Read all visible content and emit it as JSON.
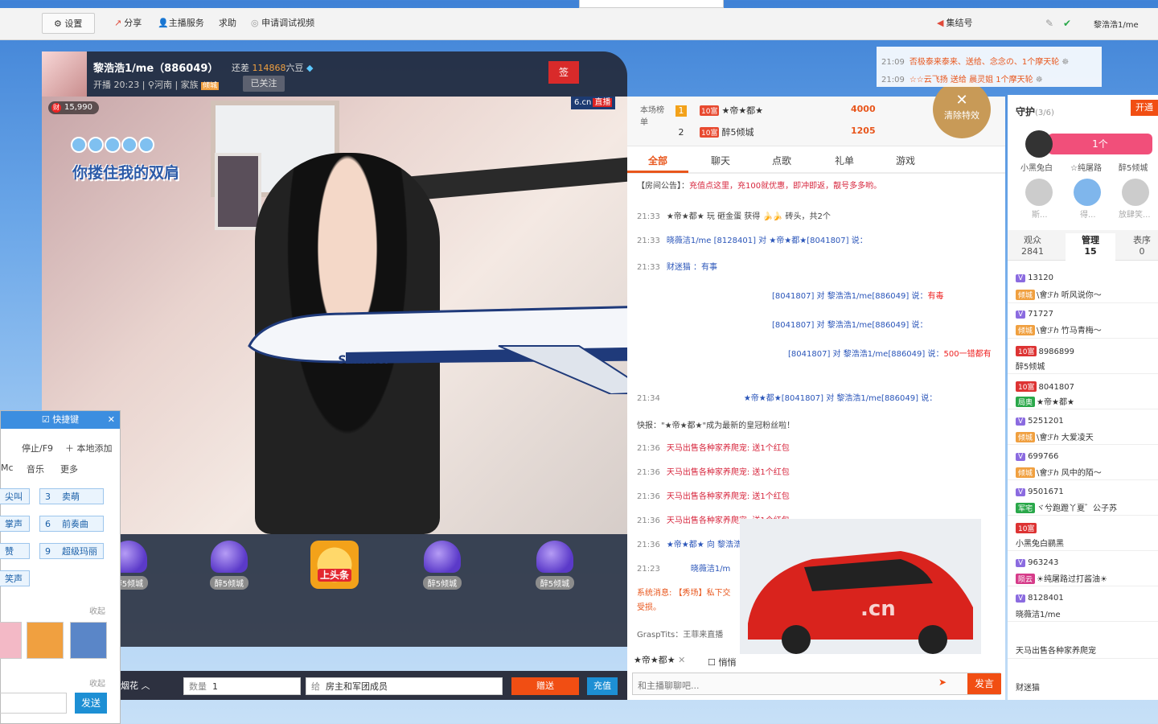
{
  "topbar": {
    "settings": "设置",
    "share": "分享",
    "anchor_service": "主播服务",
    "help": "求助",
    "apply": "申请调试视频",
    "gather": "集结号"
  },
  "topright": {
    "user": "黎浩浩1/me"
  },
  "streamer": {
    "name": "黎浩浩1/me（886049）",
    "gap_label": "还差",
    "gap_value": "114868",
    "gap_unit": "六豆",
    "start": "开播 20:23",
    "location": "河南",
    "family_label": "家族",
    "family_badge": "倾城",
    "follow": "已关注",
    "flag": "签"
  },
  "video": {
    "fortune": "15,990",
    "brand": "6.cn",
    "live": "直播",
    "title": "你搂住我的双肩"
  },
  "gifts": [
    {
      "label": "醉5倾城"
    },
    {
      "label": "醉5倾城"
    },
    {
      "label": "醉5倾城"
    },
    {
      "label": "醉5倾城"
    }
  ],
  "headline": {
    "label": "上头条"
  },
  "sendbar": {
    "gift_name": "烟花",
    "qty_label": "数量",
    "qty": "1",
    "to_label": "给",
    "to": "房主和军团成员",
    "send": "赠送",
    "charge": "充值"
  },
  "shortcut": {
    "title": "快捷键",
    "stop": "停止/F9",
    "add_local": "本地添加",
    "tab_mc": "Mc",
    "tab_music": "音乐",
    "tab_more": "更多",
    "buttons": [
      "尖叫",
      "3",
      "卖萌",
      "掌声",
      "6",
      "前奏曲",
      "赞",
      "9",
      "超级玛丽",
      "笑声"
    ],
    "fav": "收起",
    "fav2": "收起",
    "send": "发送"
  },
  "ranking": {
    "label": "本场榜单",
    "rows": [
      {
        "num": "1",
        "lvl": "10富",
        "name": "★帝★都★",
        "score": "4000"
      },
      {
        "num": "2",
        "lvl": "10富",
        "name": "醉5倾城",
        "score": "1205"
      }
    ]
  },
  "clear_fx": "清除特效",
  "chat_tabs": [
    "全部",
    "聊天",
    "点歌",
    "礼单",
    "游戏"
  ],
  "announce": {
    "label": "【房间公告】：",
    "text": "充值点这里，充100就优惠，即冲即返，靓号多多哟。"
  },
  "messages": [
    {
      "t": "21:33",
      "text": "★帝★都★ 玩 砸金蛋 获得",
      "tail": "砖头，共2个"
    },
    {
      "t": "21:33",
      "text": "晓薇洁1/me [8128401] 对 ★帝★都★[8041807] 说：",
      "tail": ""
    },
    {
      "t": "21:33",
      "text": "财迷猫 ：有事",
      "tail": ""
    },
    {
      "t": "21:33",
      "text": "[8041807] 对 黎浩浩1/me[886049] 说：",
      "tail": "有毒"
    },
    {
      "t": "21:33",
      "text": "[8041807] 对 黎浩浩1/me[886049] 说：",
      "tail": ""
    },
    {
      "t": "21:33",
      "text": "[8041807] 对 黎浩浩1/me[886049] 说：",
      "tail": "500一错都有"
    },
    {
      "t": "21:34",
      "text": "★帝★都★[8041807] 对 黎浩浩1/me[886049] 说：",
      "tail": ""
    },
    {
      "t": "",
      "text": "快报：\"★帝★都★\"成为最新的皇冠粉丝啦！",
      "tail": ""
    },
    {
      "t": "21:36",
      "text": "天马出售各种家养爬宠: 送1个红包",
      "tail": ""
    },
    {
      "t": "21:36",
      "text": "天马出售各种家养爬宠: 送1个红包",
      "tail": ""
    },
    {
      "t": "21:36",
      "text": "天马出售各种家养爬宠: 送1个红包",
      "tail": ""
    },
    {
      "t": "21:36",
      "text": "天马出售各种家养爬宠: 送1个红包",
      "tail": ""
    },
    {
      "t": "21:36",
      "text": "★帝★都★ 向 黎浩浩",
      "tail": ""
    },
    {
      "t": "21:23",
      "text": "晓薇洁1/m",
      "tail": ""
    },
    {
      "t": "",
      "text": "系统消息: 【秀场】私下交",
      "tail": ""
    },
    {
      "t": "",
      "text": "受损。",
      "tail": ""
    },
    {
      "t": "",
      "text": "GraspTits：王菲来直播",
      "tail": ""
    }
  ],
  "chat_footer": {
    "target": "★帝★都★",
    "whisper": "悄悄",
    "placeholder": "和主播聊聊吧...",
    "say": "发言"
  },
  "notes": [
    {
      "t": "21:09",
      "text": "否极泰来泰来、送给、念念の、1个摩天轮"
    },
    {
      "t": "21:09",
      "text": "☆☆云飞扬 送给 晨灵姐 1个摩天轮"
    }
  ],
  "guard": {
    "title": "守护",
    "count": "(3/6)",
    "open": "开通",
    "ribbon": "1个",
    "members": [
      "小黑兔白",
      "☆纯屠路",
      "醉5倾城",
      "斯...",
      "得...",
      "放肆笑..."
    ]
  },
  "rtabs": [
    {
      "label": "观众",
      "count": "2841"
    },
    {
      "label": "管理",
      "count": "15"
    },
    {
      "label": "表序",
      "count": "0"
    }
  ],
  "users": [
    {
      "lvl": "",
      "id": "13120",
      "sub": "倾城",
      "name": "\\會ℱℎ 听风说你～"
    },
    {
      "lvl": "",
      "id": "71727",
      "sub": "倾城",
      "name": "\\會ℱℎ 竹马青梅～"
    },
    {
      "lvl": "10富",
      "id": "8986899",
      "sub": "",
      "name": "醉5倾城"
    },
    {
      "lvl": "10富",
      "id": "8041807",
      "sub": "局奥",
      "name": "★帝★都★"
    },
    {
      "lvl": "",
      "id": "5251201",
      "sub": "倾城",
      "name": "\\會ℱℎ 大爱凌天"
    },
    {
      "lvl": "",
      "id": "699766",
      "sub": "倾城",
      "name": "\\會ℱℎ 风中的陌～"
    },
    {
      "lvl": "",
      "id": "9501671",
      "sub": "军宅",
      "name": "ヾ兮跑蹬丫夏゛公子苏"
    },
    {
      "lvl": "10富",
      "id": "",
      "sub": "",
      "name": "小黑兔白鹂黑"
    },
    {
      "lvl": "",
      "id": "963243",
      "sub": "陨云",
      "name": "☀纯屠路过打酱油☀"
    },
    {
      "lvl": "",
      "id": "8128401",
      "sub": "",
      "name": "晓薇洁1/me"
    },
    {
      "lvl": "",
      "id": "",
      "sub": "",
      "name": "天马出售各种家养爬宠"
    },
    {
      "lvl": "",
      "id": "",
      "sub": "",
      "name": "财迷猫"
    }
  ],
  "colors": {
    "accent": "#f14e13",
    "blue": "#1d8fd4",
    "header": "#1e1e28"
  }
}
